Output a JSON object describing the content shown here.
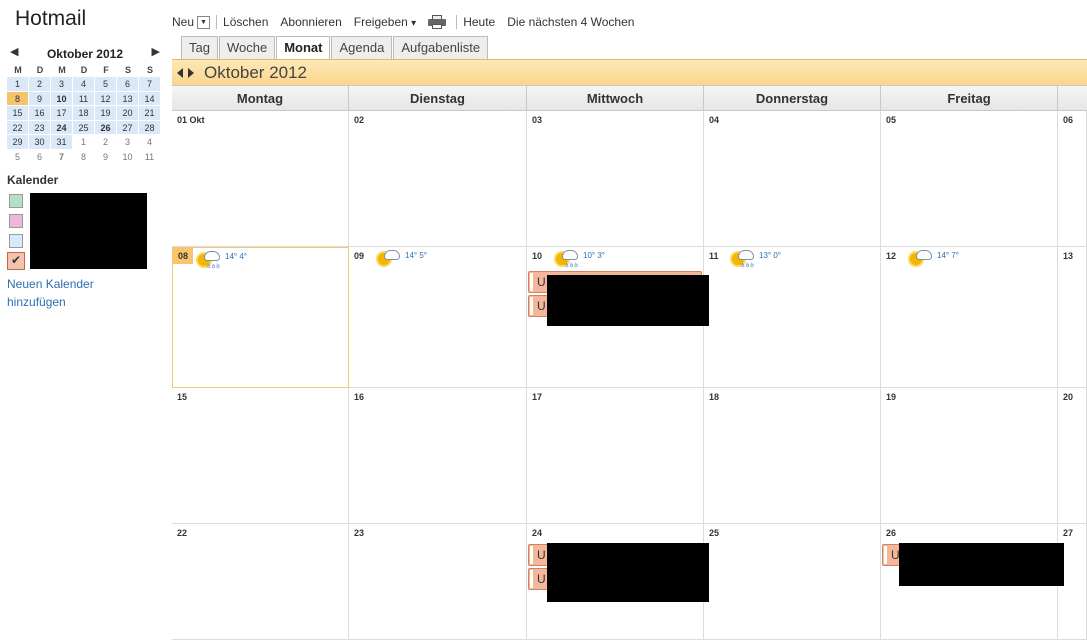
{
  "app": {
    "title": "Hotmail"
  },
  "mini_calendar": {
    "title": "Oktober 2012",
    "weekdays": [
      "M",
      "D",
      "M",
      "D",
      "F",
      "S",
      "S"
    ],
    "weeks": [
      [
        "1",
        "2",
        "3",
        "4",
        "5",
        "6",
        "7"
      ],
      [
        "8",
        "9",
        "10",
        "11",
        "12",
        "13",
        "14"
      ],
      [
        "15",
        "16",
        "17",
        "18",
        "19",
        "20",
        "21"
      ],
      [
        "22",
        "23",
        "24",
        "25",
        "26",
        "27",
        "28"
      ],
      [
        "29",
        "30",
        "31",
        "1",
        "2",
        "3",
        "4"
      ],
      [
        "5",
        "6",
        "7",
        "8",
        "9",
        "10",
        "11"
      ]
    ]
  },
  "sidebar": {
    "section_title": "Kalender",
    "add_calendar": "Neuen Kalender hinzufügen"
  },
  "toolbar": {
    "new_label": "Neu",
    "delete_label": "Löschen",
    "subscribe_label": "Abonnieren",
    "share_label": "Freigeben",
    "share_arrow": "▾",
    "today_label": "Heute",
    "next_weeks_label": "Die nächsten 4 Wochen"
  },
  "tabs": [
    {
      "label": "Tag"
    },
    {
      "label": "Woche"
    },
    {
      "label": "Monat",
      "active": true
    },
    {
      "label": "Agenda"
    },
    {
      "label": "Aufgabenliste"
    }
  ],
  "month_band": {
    "title": "Oktober 2012"
  },
  "weekday_headers": [
    "Montag",
    "Dienstag",
    "Mittwoch",
    "Donnerstag",
    "Freitag"
  ],
  "weeks": [
    [
      "01 Okt",
      "02",
      "03",
      "04",
      "05",
      "06"
    ],
    [
      "08",
      "09",
      "10",
      "11",
      "12",
      "13"
    ],
    [
      "15",
      "16",
      "17",
      "18",
      "19",
      "20"
    ],
    [
      "22",
      "23",
      "24",
      "25",
      "26",
      "27"
    ]
  ],
  "weather": {
    "mon": "14° 4°",
    "tue": "14° 5°",
    "wed": "10° 3°",
    "thu": "13° 0°",
    "fri": "14° 7°"
  },
  "events": {
    "letter": "U"
  },
  "colors": {
    "accent_band": "#fbd68c",
    "event_fill": "#f5b79a",
    "today_highlight": "#f9c46b",
    "link": "#2a6fb3"
  }
}
